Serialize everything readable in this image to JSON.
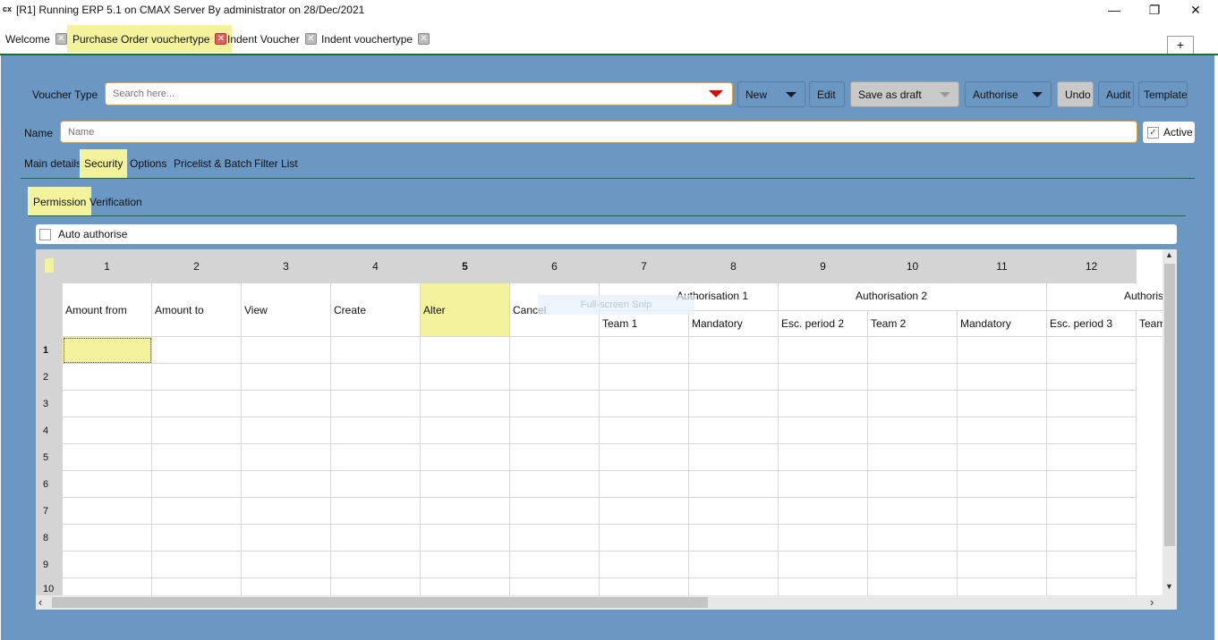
{
  "window": {
    "icon_text": "cx",
    "title": "[R1] Running ERP 5.1 on CMAX Server By administrator on 28/Dec/2021",
    "minimize": "—",
    "maximize": "❐",
    "close": "✕"
  },
  "tabs": [
    {
      "label": "Welcome"
    },
    {
      "label": "Purchase Order vouchertype"
    },
    {
      "label": "Indent Voucher"
    },
    {
      "label": "Indent vouchertype"
    }
  ],
  "tab_close_glyph": "✕",
  "plus_label": "+",
  "toolbar": {
    "voucher_type_label": "Voucher Type",
    "search_placeholder": "Search here...",
    "new_label": "New",
    "edit_label": "Edit",
    "save_draft_label": "Save as draft",
    "authorise_label": "Authorise",
    "undo_label": "Undo",
    "audit_label": "Audit",
    "template_label": "Template"
  },
  "name_field": {
    "label": "Name",
    "placeholder": "Name"
  },
  "active": {
    "label": "Active",
    "check": "✓"
  },
  "section_tabs": [
    "Main details",
    "Security",
    "Options",
    "Pricelist & Batch",
    "Filter List"
  ],
  "sub_tabs": [
    "Permission",
    "Verification"
  ],
  "auto_authorise_label": "Auto authorise",
  "grid": {
    "col_numbers": [
      "1",
      "2",
      "3",
      "4",
      "5",
      "6",
      "7",
      "8",
      "9",
      "10",
      "11",
      "12"
    ],
    "headers": [
      "Amount from",
      "Amount to",
      "View",
      "Create",
      "Alter",
      "Cancel"
    ],
    "group_headers": [
      "Authorisation 1",
      "Authorisation 2",
      "Authoris"
    ],
    "sub_headers": [
      "Team 1",
      "Mandatory",
      "Esc. period 2",
      "Team 2",
      "Mandatory",
      "Esc. period 3",
      "Team"
    ],
    "row_numbers": [
      "1",
      "2",
      "3",
      "4",
      "5",
      "6",
      "7",
      "8",
      "9",
      "10"
    ]
  },
  "scroll": {
    "up": "▲",
    "down": "▼",
    "left": "‹",
    "right": "›"
  },
  "overlay_text": "Full-screen Snip",
  "colors": {
    "main_bg": "#6b97c3",
    "highlight": "#f3f39b",
    "accent_border": "#e0a030"
  }
}
